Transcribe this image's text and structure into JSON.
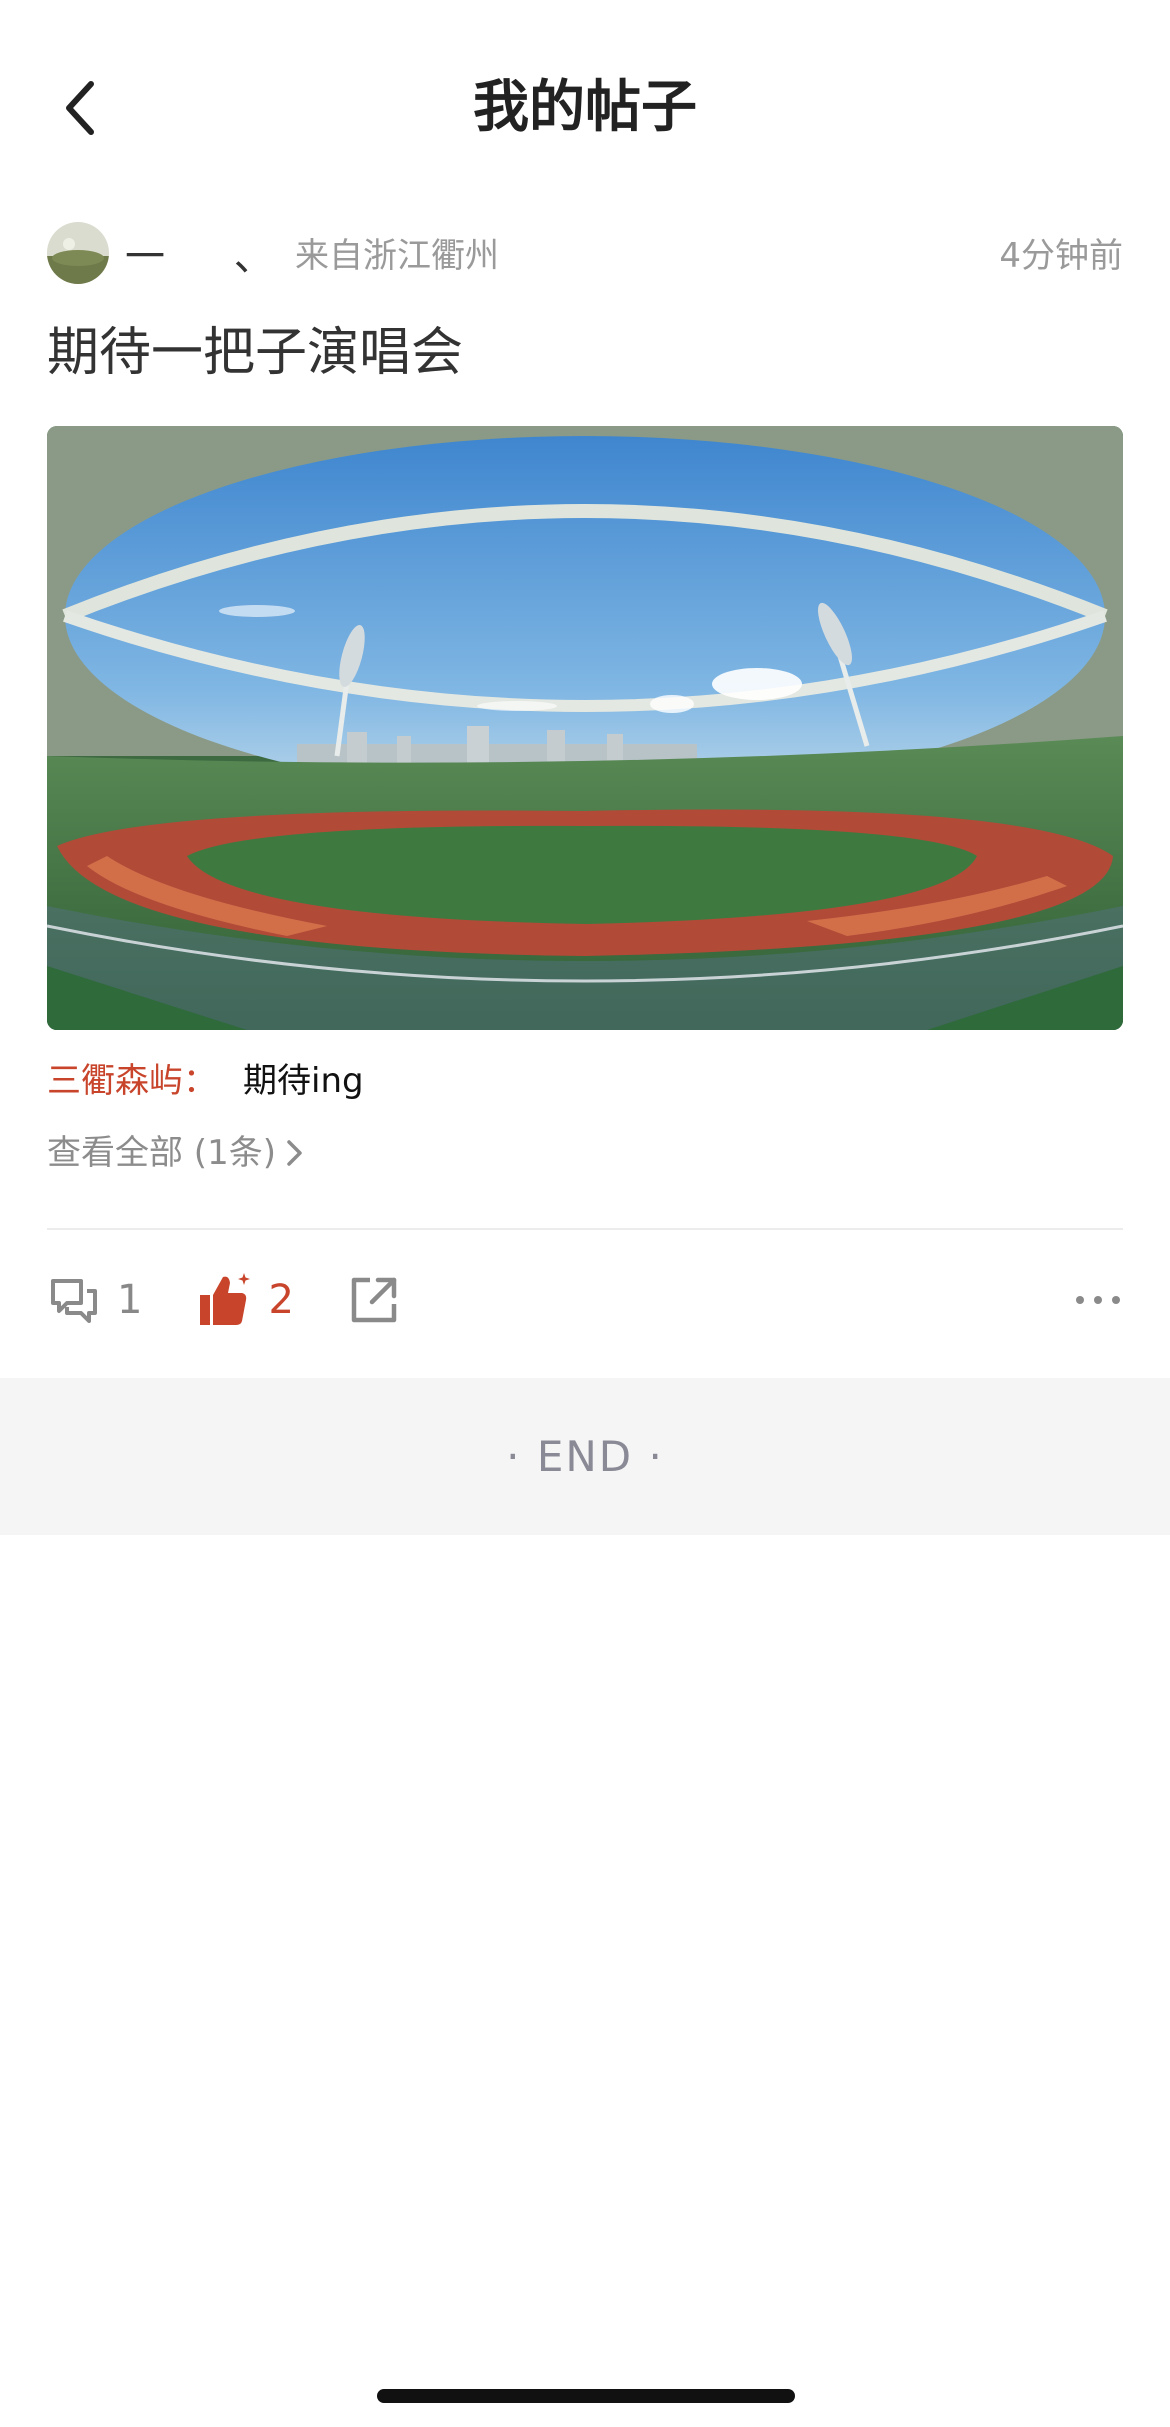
{
  "nav": {
    "title": "我的帖子"
  },
  "post": {
    "username": "一 、",
    "location": "来自浙江衢州",
    "time": "4分钟前",
    "title": "期待一把子演唱会"
  },
  "comment": {
    "author": "三衢森屿：",
    "text": "期待ing"
  },
  "view_all": "查看全部 (1条)",
  "actions": {
    "comment_count": "1",
    "like_count": "2"
  },
  "end_text": "· END ·",
  "colors": {
    "accent": "#c8452c",
    "muted": "#9a9a9a",
    "band": "#f5f5f5"
  },
  "icons": [
    "back-icon",
    "comment-icon",
    "thumbs-up-icon",
    "share-icon",
    "more-icon",
    "chevron-right-icon"
  ]
}
